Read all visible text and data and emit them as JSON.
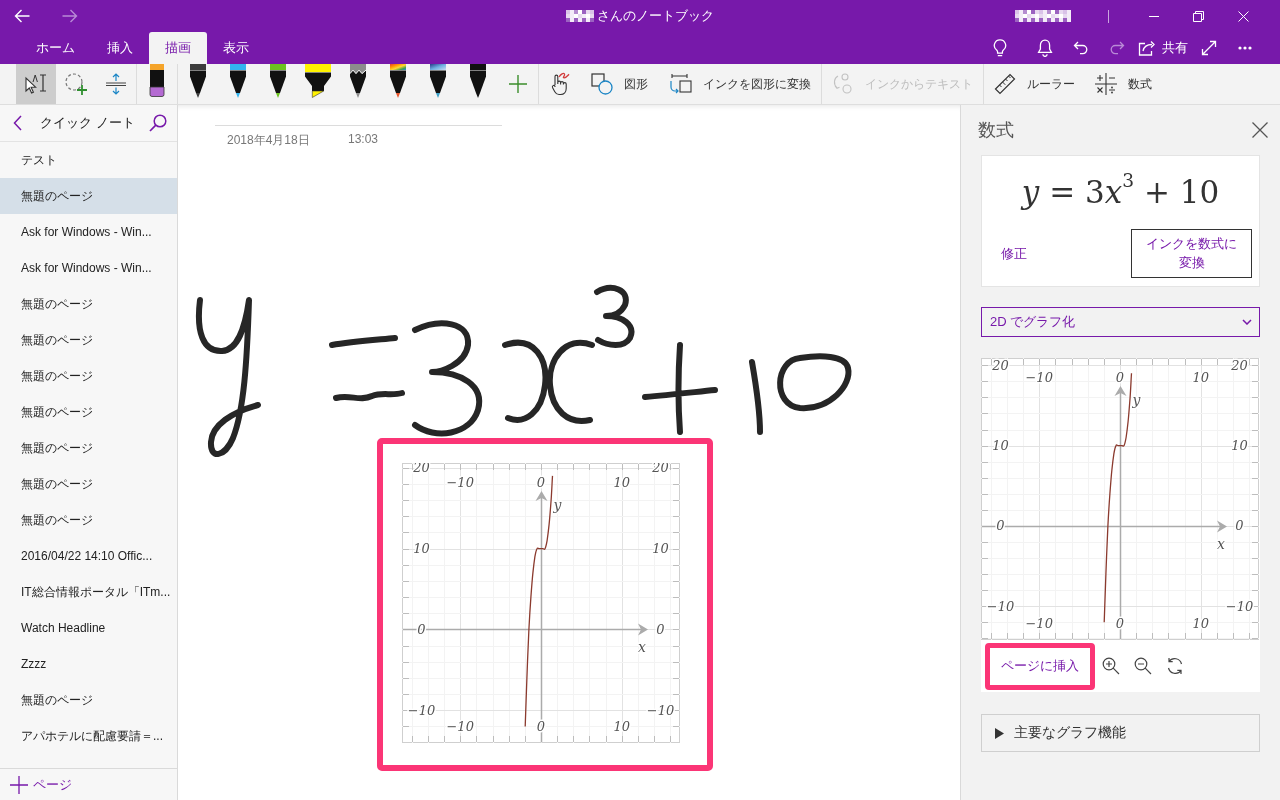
{
  "window": {
    "title": "さんのノートブック"
  },
  "nav": [
    {
      "kind": "back",
      "disabled": false
    },
    {
      "kind": "forward",
      "disabled": true
    }
  ],
  "ribbon": {
    "tabs": [
      {
        "label": "ホーム",
        "selected": false
      },
      {
        "label": "挿入",
        "selected": false
      },
      {
        "label": "描画",
        "selected": true
      },
      {
        "label": "表示",
        "selected": false
      }
    ],
    "actions": [
      {
        "kind": "tips",
        "disabled": false
      },
      {
        "kind": "notifications",
        "disabled": false
      },
      {
        "kind": "undo",
        "disabled": false
      },
      {
        "kind": "redo",
        "disabled": true
      },
      {
        "kind": "share",
        "label": "共有",
        "disabled": false
      },
      {
        "kind": "fullscreen",
        "disabled": false
      },
      {
        "kind": "more",
        "disabled": false
      }
    ]
  },
  "toolbar": {
    "tool_groups": [
      [
        {
          "kind": "lasso_select",
          "selected": true
        },
        {
          "kind": "lasso_add",
          "selected": false
        },
        {
          "kind": "insert_space",
          "selected": false
        }
      ],
      [
        {
          "kind": "eraser",
          "selected": false
        }
      ],
      [
        {
          "kind": "pen",
          "color": "#3c3c3c",
          "selected": false
        },
        {
          "kind": "pen",
          "color": "#33b4ef",
          "selected": false
        },
        {
          "kind": "pen",
          "color": "#6cc31f",
          "selected": false
        },
        {
          "kind": "highlighter",
          "color": "#fff200",
          "selected": false
        },
        {
          "kind": "pencil",
          "color": "#8c8c8c",
          "selected": false
        },
        {
          "kind": "rainbow_pen",
          "selected": false
        },
        {
          "kind": "galaxy_pen",
          "selected": false
        },
        {
          "kind": "pen",
          "color": "#111111",
          "selected": false
        }
      ]
    ],
    "command_groups": [
      [
        {
          "kind": "touch_draw",
          "disabled": false
        },
        {
          "kind": "shapes",
          "label": "図形",
          "disabled": false
        },
        {
          "kind": "ink_to_shape",
          "label": "インクを図形に変換",
          "disabled": false
        }
      ],
      [
        {
          "kind": "ink_to_text",
          "label": "インクからテキスト",
          "disabled": true
        }
      ],
      [
        {
          "kind": "ruler",
          "label": "ルーラー",
          "disabled": false
        },
        {
          "kind": "math",
          "label": "数式",
          "disabled": false
        }
      ]
    ]
  },
  "sidebar": {
    "title": "クイック ノート",
    "items": [
      {
        "label": "テスト",
        "selected": false
      },
      {
        "label": "無題のページ",
        "selected": true
      },
      {
        "label": "Ask for Windows - Win...",
        "selected": false
      },
      {
        "label": "Ask for Windows - Win...",
        "selected": false
      },
      {
        "label": "無題のページ",
        "selected": false
      },
      {
        "label": "無題のページ",
        "selected": false
      },
      {
        "label": "無題のページ",
        "selected": false
      },
      {
        "label": "無題のページ",
        "selected": false
      },
      {
        "label": "無題のページ",
        "selected": false
      },
      {
        "label": "無題のページ",
        "selected": false
      },
      {
        "label": "無題のページ",
        "selected": false
      },
      {
        "label": "2016/04/22 14:10 Offic...",
        "selected": false
      },
      {
        "label": "IT総合情報ポータル「ITm...",
        "selected": false
      },
      {
        "label": "Watch Headline",
        "selected": false
      },
      {
        "label": "Zzzz",
        "selected": false
      },
      {
        "label": "無題のページ",
        "selected": false
      },
      {
        "label": "アパホテルに配慮要請＝...",
        "selected": false
      }
    ],
    "add_page": "ページ"
  },
  "page": {
    "date": "2018年4月18日",
    "time": "13:03",
    "graph": {
      "highlighted": true,
      "top_tick_labels": [
        "−10",
        "0",
        "10"
      ],
      "right_tick_labels": [
        "20",
        "10",
        "0",
        "−10"
      ],
      "chart_data": {
        "type": "line",
        "xlabel": "x",
        "ylabel": "y",
        "grid": true,
        "x": [
          -1.95,
          -1.75,
          -1.5,
          -1.25,
          -1,
          -0.75,
          -0.5,
          -0.25,
          0,
          0.25,
          0.5,
          0.75,
          1,
          1.25,
          1.42
        ],
        "series": [
          {
            "color": "#8b3a2e",
            "values": [
              -12,
              -6,
              0,
              4,
              7,
              9,
              10,
              10,
              10,
              10,
              10,
              11,
              13,
              16,
              19
            ]
          }
        ],
        "xlim": [
          -17.2,
          17.2
        ],
        "ylim": [
          -14.05,
          20.6
        ],
        "xticks": [
          {
            "value": -10,
            "label": "−10"
          },
          0,
          10
        ],
        "yticks": [
          {
            "value": -10,
            "label": "−10"
          },
          0,
          10,
          20
        ]
      }
    }
  },
  "math_panel": {
    "title": "数式",
    "equation": "y = 3x$^{3}$ + 10",
    "edit_link": "修正",
    "convert_button": "インクを数式に変換",
    "graph_mode": "2D でグラフ化",
    "graph": {
      "top_tick_labels": [
        "−10",
        "0",
        "10"
      ],
      "right_tick_labels": [
        "20",
        "10",
        "0",
        "−10"
      ],
      "chart_data": {
        "type": "line",
        "xlabel": "x",
        "ylabel": "y",
        "grid": true,
        "x": [
          -1.95,
          -1.75,
          -1.5,
          -1.25,
          -1,
          -0.75,
          -0.5,
          -0.25,
          0,
          0.25,
          0.5,
          0.75,
          1,
          1.25,
          1.42
        ],
        "series": [
          {
            "color": "#8b3a2e",
            "values": [
              -12,
              -6,
              0,
              4,
              7,
              9,
              10,
              10,
              10,
              10,
              10,
              11,
              13,
              16,
              19
            ]
          }
        ],
        "xlim": [
          -17.2,
          17.2
        ],
        "ylim": [
          -14.2,
          20.9
        ],
        "xticks": [
          {
            "value": -10,
            "label": "−10"
          },
          0,
          10
        ],
        "yticks": [
          {
            "value": -10,
            "label": "−10"
          },
          0,
          10,
          20
        ]
      }
    },
    "insert_link": {
      "label": "ページに挿入",
      "highlighted": true
    },
    "features": {
      "label": "主要なグラフ機能",
      "expanded": false
    }
  }
}
